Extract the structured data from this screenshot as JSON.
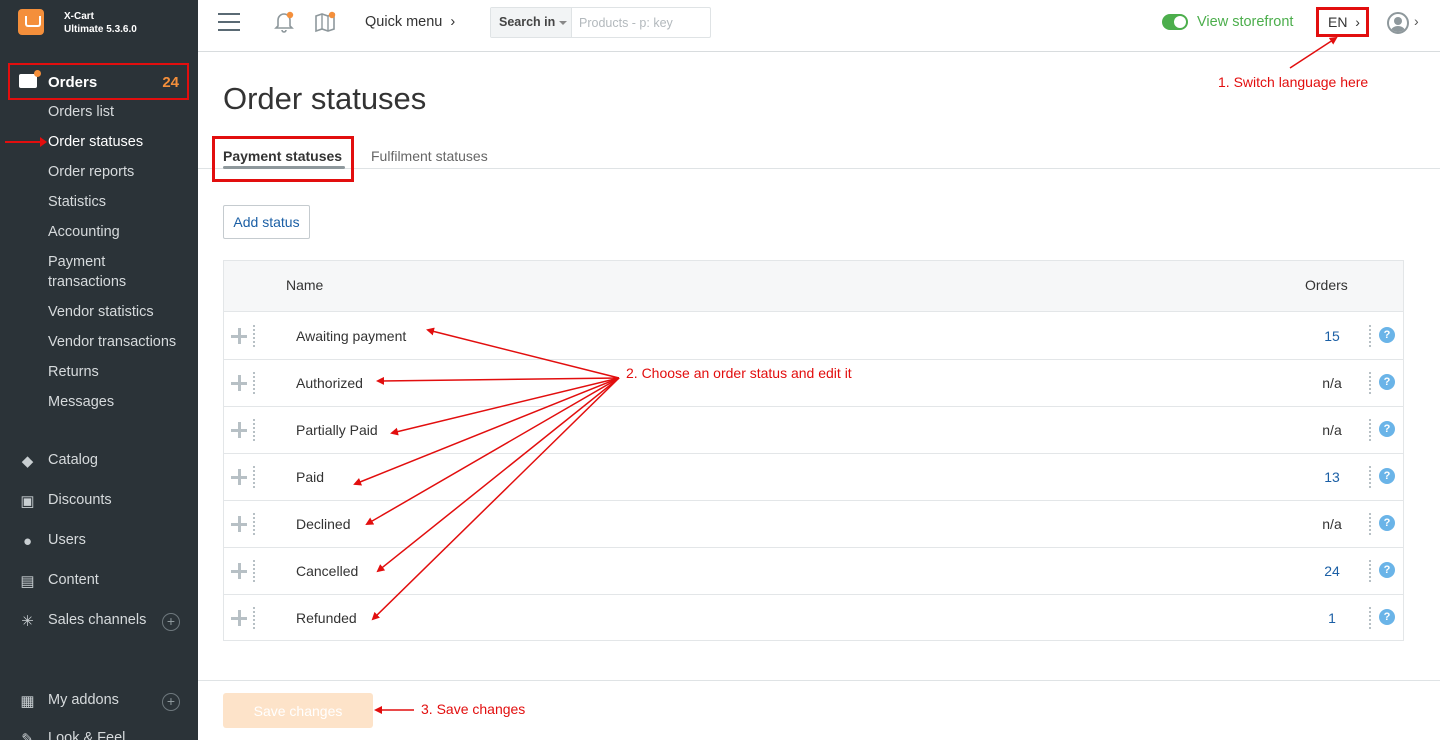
{
  "brand": {
    "line1": "X-Cart",
    "line2": "Ultimate 5.3.6.0"
  },
  "sidebar": {
    "orders_label": "Orders",
    "orders_count": "24",
    "sub_items": [
      "Orders list",
      "Order statuses",
      "Order reports",
      "Statistics",
      "Accounting",
      "Payment",
      "transactions",
      "Vendor statistics",
      "Vendor transactions",
      "Returns",
      "Messages"
    ],
    "main_items": [
      {
        "label": "Catalog",
        "icon": "tag-icon"
      },
      {
        "label": "Discounts",
        "icon": "gift-icon"
      },
      {
        "label": "Users",
        "icon": "users-icon"
      },
      {
        "label": "Content",
        "icon": "content-icon"
      },
      {
        "label": "Sales channels",
        "icon": "network-icon"
      },
      {
        "label": "My addons",
        "icon": "puzzle-icon"
      },
      {
        "label": "Look & Feel",
        "icon": "brush-icon"
      }
    ]
  },
  "topbar": {
    "quick_menu": "Quick menu",
    "search_in": "Search in",
    "search_placeholder": "Products - p: key",
    "view_storefront": "View storefront",
    "language": "EN"
  },
  "page": {
    "title": "Order statuses",
    "tabs": [
      "Payment statuses",
      "Fulfilment statuses"
    ],
    "add_status": "Add status",
    "col_name": "Name",
    "col_orders": "Orders",
    "rows": [
      {
        "name": "Awaiting payment",
        "orders": "15",
        "link": true
      },
      {
        "name": "Authorized",
        "orders": "n/a",
        "link": false
      },
      {
        "name": "Partially Paid",
        "orders": "n/a",
        "link": false
      },
      {
        "name": "Paid",
        "orders": "13",
        "link": true
      },
      {
        "name": "Declined",
        "orders": "n/a",
        "link": false
      },
      {
        "name": "Cancelled",
        "orders": "24",
        "link": true
      },
      {
        "name": "Refunded",
        "orders": "1",
        "link": true
      }
    ],
    "save_changes": "Save changes"
  },
  "annotations": {
    "switch_language": "1. Switch language here",
    "choose_status": "2. Choose an order status and edit it",
    "save_changes": "3. Save changes"
  },
  "colors": {
    "accent": "#f48f3b",
    "annotation": "#e20e0e",
    "link": "#1b5fa5",
    "storefront_green": "#4cae4c"
  }
}
